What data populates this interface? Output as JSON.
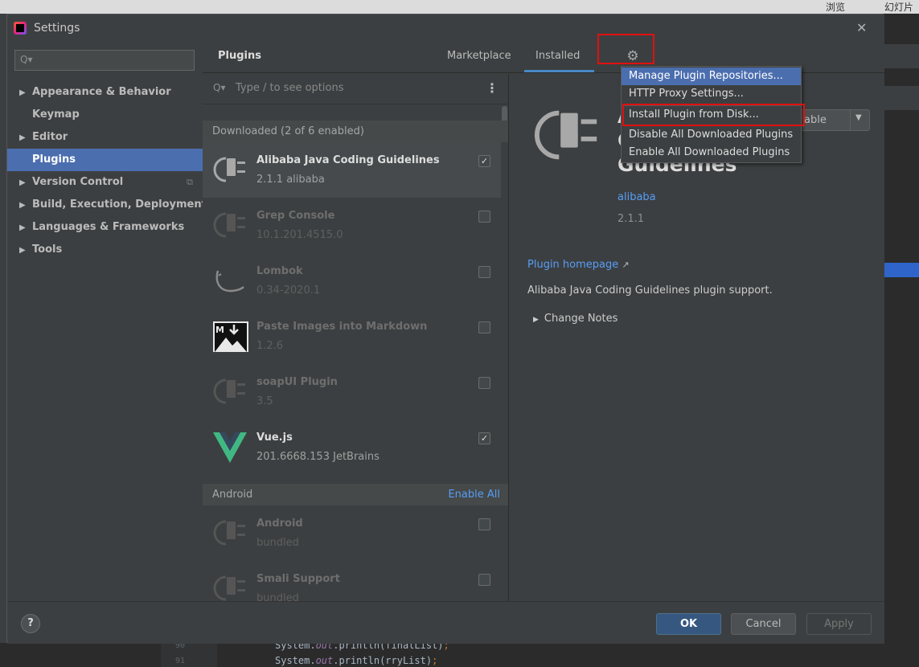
{
  "background": {
    "top_right_text_1": "浏览",
    "top_right_text_2": "幻灯片",
    "editor_lines": [
      {
        "num": "90",
        "prefix": "System.",
        "field": "out",
        "call": ".println(finalList)",
        "end": ";"
      },
      {
        "num": "91",
        "prefix": "System.",
        "field": "out",
        "call": ".println(rryList)",
        "end": ";"
      }
    ]
  },
  "window": {
    "title": "Settings"
  },
  "sidebar": {
    "search_placeholder": "",
    "items": [
      {
        "label": "Appearance & Behavior",
        "has_arrow": true
      },
      {
        "label": "Keymap",
        "has_arrow": false
      },
      {
        "label": "Editor",
        "has_arrow": true
      },
      {
        "label": "Plugins",
        "has_arrow": false,
        "selected": true
      },
      {
        "label": "Version Control",
        "has_arrow": true
      },
      {
        "label": "Build, Execution, Deployment",
        "has_arrow": true
      },
      {
        "label": "Languages & Frameworks",
        "has_arrow": true
      },
      {
        "label": "Tools",
        "has_arrow": true
      }
    ]
  },
  "plugins": {
    "title": "Plugins",
    "tabs": {
      "marketplace": "Marketplace",
      "installed": "Installed"
    },
    "search_placeholder": "Type / to see options",
    "downloaded_header": "Downloaded (2 of 6 enabled)",
    "android_header": "Android",
    "enable_all": "Enable All",
    "downloaded": [
      {
        "name": "Alibaba Java Coding Guidelines",
        "meta": "2.1.1  alibaba",
        "enabled": true,
        "icon": "plug-icon"
      },
      {
        "name": "Grep Console",
        "meta": "10.1.201.4515.0",
        "enabled": false,
        "icon": "plug-icon"
      },
      {
        "name": "Lombok",
        "meta": "0.34-2020.1",
        "enabled": false,
        "icon": "lombok-icon"
      },
      {
        "name": "Paste Images into Markdown",
        "meta": "1.2.6",
        "enabled": false,
        "icon": "markdown-image-icon"
      },
      {
        "name": "soapUI Plugin",
        "meta": "3.5",
        "enabled": false,
        "icon": "plug-icon"
      },
      {
        "name": "Vue.js",
        "meta": "201.6668.153  JetBrains",
        "enabled": true,
        "icon": "vue-icon"
      }
    ],
    "android": [
      {
        "name": "Android",
        "meta": "bundled",
        "enabled": false,
        "icon": "plug-icon"
      },
      {
        "name": "Smali Support",
        "meta": "bundled",
        "enabled": false,
        "icon": "plug-icon"
      }
    ]
  },
  "detail": {
    "name_line_1": "A",
    "name_line_2": "C",
    "name_line_3": "Guidelines",
    "vendor": "alibaba",
    "version": "2.1.1",
    "homepage": "Plugin homepage",
    "description": "Alibaba Java Coding Guidelines plugin support.",
    "change_notes": "Change Notes",
    "disable_button": "able"
  },
  "gear_menu": {
    "items": [
      "Manage Plugin Repositories...",
      "HTTP Proxy Settings...",
      "Install Plugin from Disk...",
      "Disable All Downloaded Plugins",
      "Enable All Downloaded Plugins"
    ],
    "active_index": 0
  },
  "footer": {
    "help": "?",
    "ok": "OK",
    "cancel": "Cancel",
    "apply": "Apply"
  },
  "colors": {
    "accent": "#4b6eaf",
    "link": "#589df6",
    "highlight_box": "#e01010"
  }
}
